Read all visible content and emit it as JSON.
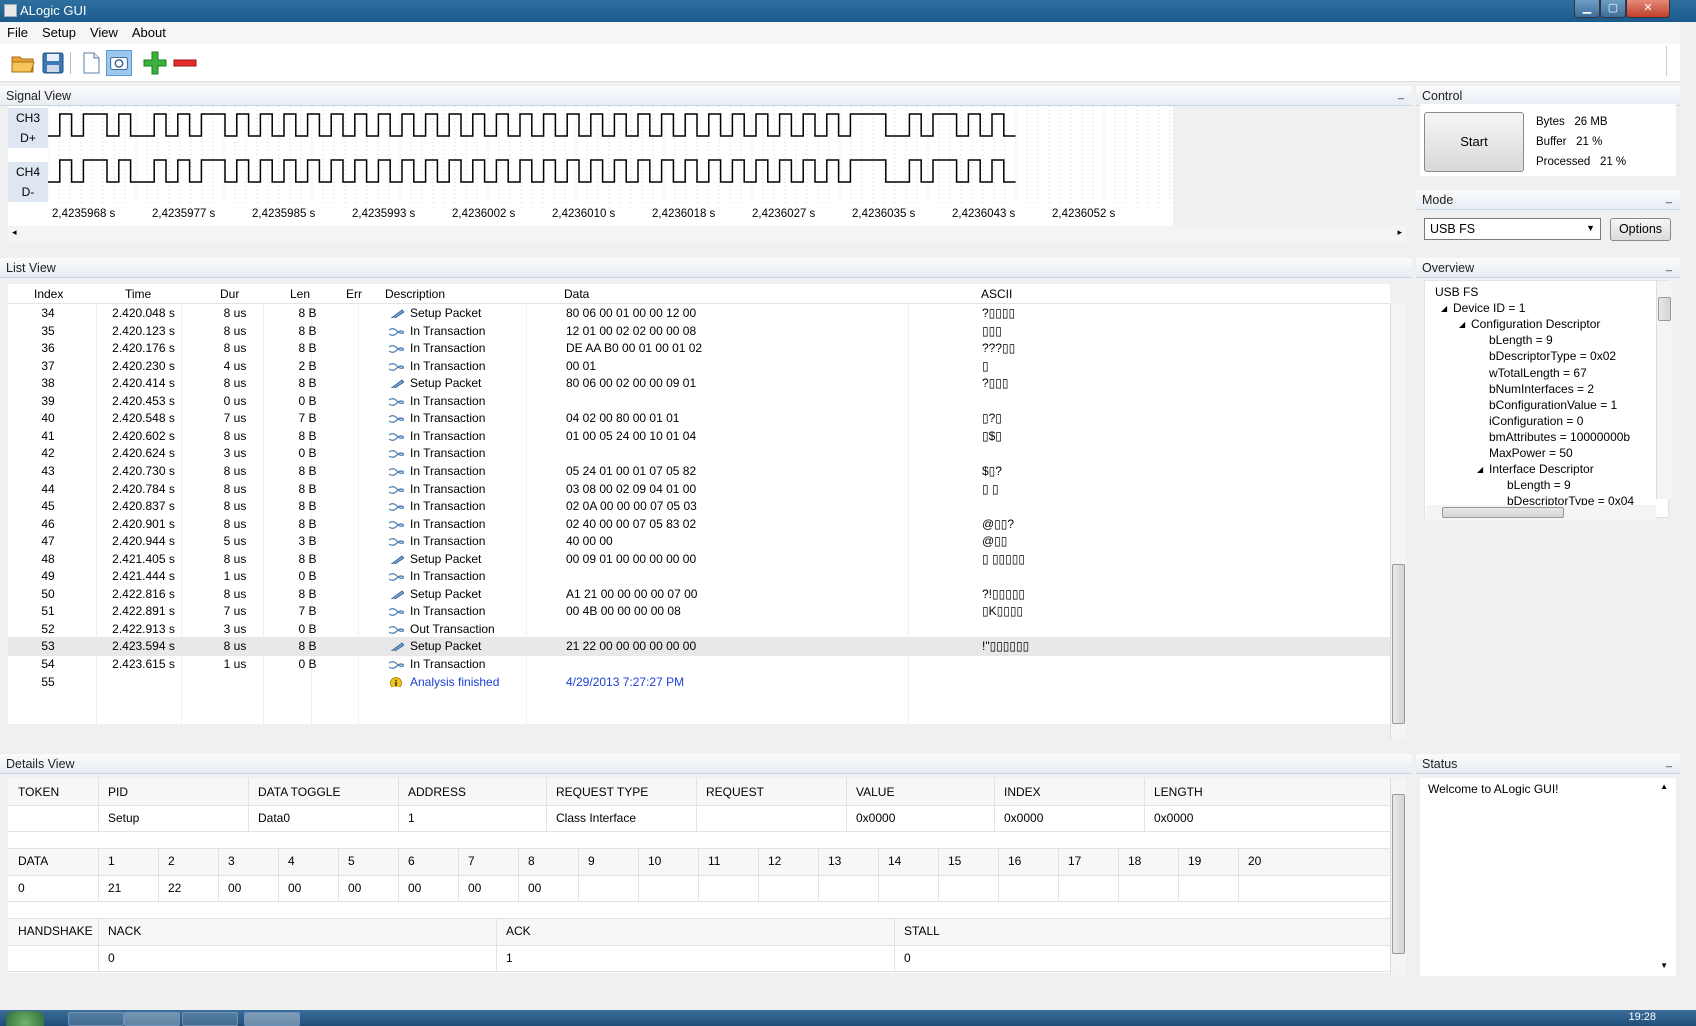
{
  "window": {
    "title": "ALogic GUI"
  },
  "menu": [
    "File",
    "Setup",
    "View",
    "About"
  ],
  "panels": {
    "signal": "Signal View",
    "list": "List View",
    "details": "Details View",
    "control": "Control",
    "mode": "Mode",
    "overview": "Overview",
    "status": "Status"
  },
  "signal": {
    "channels": [
      "CH3",
      "D+",
      "CH4",
      "D-"
    ],
    "ticks": [
      "2,4235968 s",
      "2,4235977 s",
      "2,4235985 s",
      "2,4235993 s",
      "2,4236002 s",
      "2,4236010 s",
      "2,4236018 s",
      "2,4236027 s",
      "2,4236035 s",
      "2,4236043 s",
      "2,4236052 s"
    ]
  },
  "list": {
    "columns": [
      "Index",
      "Time",
      "Dur",
      "Len",
      "Err",
      "Description",
      "Data",
      "ASCII"
    ],
    "rows": [
      {
        "index": "34",
        "time": "2.420.048 s",
        "dur": "8 us",
        "len": "8 B",
        "desc": "Setup Packet",
        "data": "80 06 00 01 00 00 12 00",
        "ascii": "?▯▯▯▯"
      },
      {
        "index": "35",
        "time": "2.420.123 s",
        "dur": "8 us",
        "len": "8 B",
        "desc": "In Transaction",
        "data": "12 01 00 02 02 00 00 08",
        "ascii": "▯▯▯"
      },
      {
        "index": "36",
        "time": "2.420.176 s",
        "dur": "8 us",
        "len": "8 B",
        "desc": "In Transaction",
        "data": "DE AA B0 00 01 00 01 02",
        "ascii": "???▯▯"
      },
      {
        "index": "37",
        "time": "2.420.230 s",
        "dur": "4 us",
        "len": "2 B",
        "desc": "In Transaction",
        "data": "00 01",
        "ascii": "▯"
      },
      {
        "index": "38",
        "time": "2.420.414 s",
        "dur": "8 us",
        "len": "8 B",
        "desc": "Setup Packet",
        "data": "80 06 00 02 00 00 09 01",
        "ascii": "?▯▯▯"
      },
      {
        "index": "39",
        "time": "2.420.453 s",
        "dur": "0 us",
        "len": "0 B",
        "desc": "In Transaction",
        "data": "",
        "ascii": ""
      },
      {
        "index": "40",
        "time": "2.420.548 s",
        "dur": "7 us",
        "len": "7 B",
        "desc": "In Transaction",
        "data": "04 02 00 80 00 01 01",
        "ascii": "▯?▯"
      },
      {
        "index": "41",
        "time": "2.420.602 s",
        "dur": "8 us",
        "len": "8 B",
        "desc": "In Transaction",
        "data": "01 00 05 24 00 10 01 04",
        "ascii": "▯$▯"
      },
      {
        "index": "42",
        "time": "2.420.624 s",
        "dur": "3 us",
        "len": "0 B",
        "desc": "In Transaction",
        "data": "",
        "ascii": ""
      },
      {
        "index": "43",
        "time": "2.420.730 s",
        "dur": "8 us",
        "len": "8 B",
        "desc": "In Transaction",
        "data": "05 24 01 00 01 07 05 82",
        "ascii": "$▯?"
      },
      {
        "index": "44",
        "time": "2.420.784 s",
        "dur": "8 us",
        "len": "8 B",
        "desc": "In Transaction",
        "data": "03 08 00 02 09 04 01 00",
        "ascii": "▯          ▯"
      },
      {
        "index": "45",
        "time": "2.420.837 s",
        "dur": "8 us",
        "len": "8 B",
        "desc": "In Transaction",
        "data": "02 0A 00 00 00 07 05 03",
        "ascii": ""
      },
      {
        "index": "46",
        "time": "2.420.901 s",
        "dur": "8 us",
        "len": "8 B",
        "desc": "In Transaction",
        "data": "02 40 00 00 07 05 83 02",
        "ascii": "@▯▯?"
      },
      {
        "index": "47",
        "time": "2.420.944 s",
        "dur": "5 us",
        "len": "3 B",
        "desc": "In Transaction",
        "data": "40 00 00",
        "ascii": "@▯▯"
      },
      {
        "index": "48",
        "time": "2.421.405 s",
        "dur": "8 us",
        "len": "8 B",
        "desc": "Setup Packet",
        "data": "00 09 01 00 00 00 00 00",
        "ascii": "▯          ▯▯▯▯▯"
      },
      {
        "index": "49",
        "time": "2.421.444 s",
        "dur": "1 us",
        "len": "0 B",
        "desc": "In Transaction",
        "data": "",
        "ascii": ""
      },
      {
        "index": "50",
        "time": "2.422.816 s",
        "dur": "8 us",
        "len": "8 B",
        "desc": "Setup Packet",
        "data": "A1 21 00 00 00 00 07 00",
        "ascii": "?!▯▯▯▯▯"
      },
      {
        "index": "51",
        "time": "2.422.891 s",
        "dur": "7 us",
        "len": "7 B",
        "desc": "In Transaction",
        "data": "00 4B 00 00 00 00 08",
        "ascii": "▯K▯▯▯▯"
      },
      {
        "index": "52",
        "time": "2.422.913 s",
        "dur": "3 us",
        "len": "0 B",
        "desc": "Out Transaction",
        "data": "",
        "ascii": ""
      },
      {
        "index": "53",
        "time": "2.423.594 s",
        "dur": "8 us",
        "len": "8 B",
        "desc": "Setup Packet",
        "data": "21 22 00 00 00 00 00 00",
        "ascii": "!\"▯▯▯▯▯▯"
      },
      {
        "index": "54",
        "time": "2.423.615 s",
        "dur": "1 us",
        "len": "0 B",
        "desc": "In Transaction",
        "data": "",
        "ascii": ""
      },
      {
        "index": "55",
        "time": "",
        "dur": "",
        "len": "",
        "desc": "Analysis finished",
        "data": "4/29/2013 7:27:27 PM",
        "ascii": ""
      }
    ]
  },
  "control": {
    "start_label": "Start",
    "stats": [
      {
        "label": "Bytes",
        "value": "26 MB"
      },
      {
        "label": "Buffer",
        "value": "21 %"
      },
      {
        "label": "Processed",
        "value": "21 %"
      }
    ]
  },
  "mode": {
    "selected": "USB FS",
    "options_label": "Options"
  },
  "overview": {
    "nodes": [
      {
        "text": "USB FS",
        "level": 0,
        "expander": false
      },
      {
        "text": "Device ID = 1",
        "level": 1,
        "expander": true
      },
      {
        "text": "Configuration Descriptor",
        "level": 2,
        "expander": true
      },
      {
        "text": "bLength = 9",
        "level": 3,
        "expander": false
      },
      {
        "text": "bDescriptorType = 0x02",
        "level": 3,
        "expander": false
      },
      {
        "text": "wTotalLength = 67",
        "level": 3,
        "expander": false
      },
      {
        "text": "bNumInterfaces = 2",
        "level": 3,
        "expander": false
      },
      {
        "text": "bConfigurationValue = 1",
        "level": 3,
        "expander": false
      },
      {
        "text": "iConfiguration = 0",
        "level": 3,
        "expander": false
      },
      {
        "text": "bmAttributes = 10000000b",
        "level": 3,
        "expander": false
      },
      {
        "text": "MaxPower = 50",
        "level": 3,
        "expander": false
      },
      {
        "text": "Interface Descriptor",
        "level": 3,
        "expander": true
      },
      {
        "text": "bLength = 9",
        "level": 4,
        "expander": false
      },
      {
        "text": "bDescriptorType = 0x04",
        "level": 4,
        "expander": false
      }
    ]
  },
  "details": {
    "token": {
      "headers": [
        "TOKEN",
        "PID",
        "DATA TOGGLE",
        "ADDRESS",
        "REQUEST TYPE",
        "REQUEST",
        "VALUE",
        "INDEX",
        "LENGTH"
      ],
      "values": [
        "",
        "Setup",
        "Data0",
        "1",
        "Class Interface",
        "",
        "0x0000",
        "0x0000",
        "0x0000"
      ]
    },
    "data": {
      "headers": [
        "DATA",
        "1",
        "2",
        "3",
        "4",
        "5",
        "6",
        "7",
        "8",
        "9",
        "10",
        "11",
        "12",
        "13",
        "14",
        "15",
        "16",
        "17",
        "18",
        "19",
        "20"
      ],
      "values": [
        "0",
        "21",
        "22",
        "00",
        "00",
        "00",
        "00",
        "00",
        "00",
        "",
        "",
        "",
        "",
        "",
        "",
        "",
        "",
        "",
        "",
        "",
        ""
      ]
    },
    "handshake": {
      "headers": [
        "HANDSHAKE",
        "NACK",
        "ACK",
        "STALL"
      ],
      "values": [
        "",
        "0",
        "1",
        "0"
      ]
    }
  },
  "status": {
    "message": "Welcome to ALogic GUI!"
  },
  "taskbar": {
    "clock": "19:28"
  }
}
